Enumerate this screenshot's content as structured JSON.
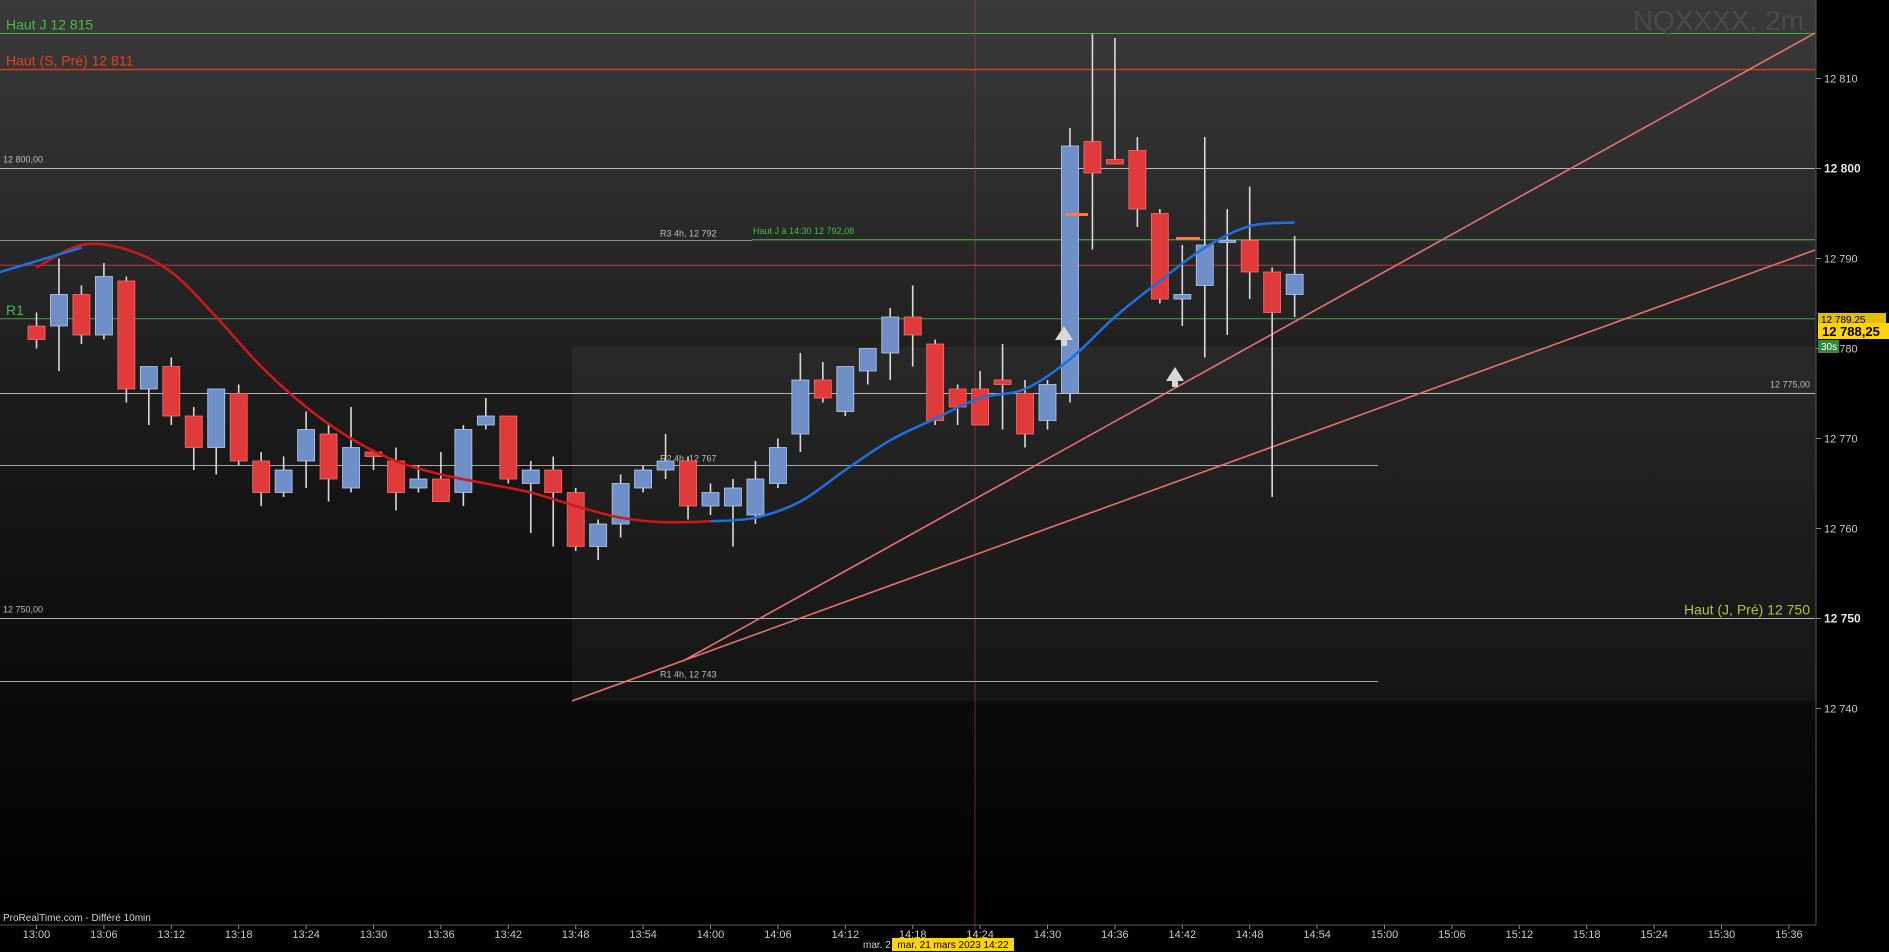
{
  "symbol": "NQXXXX, 2m",
  "watermark": "ProRealTime.com - Différé 10min",
  "crosshair_date": "mar. 21 mars 2023 14:22",
  "crosshair_date_prefix": "mar. 2",
  "price_tag": "12 788,25",
  "price_tag_small": "12 789,25",
  "timer_tag": "30s",
  "colors": {
    "up": "#6f8fc9",
    "down": "#e03a3a",
    "ma_red": "#d01818",
    "ma_blue": "#1e6fe0",
    "trend": "#e87070",
    "green": "#4bb84b",
    "orange": "#ff5a1e"
  },
  "chart_data": {
    "type": "candlestick",
    "timeframe": "2m",
    "ylim": [
      12735,
      12819
    ],
    "x_ticks": [
      "13:00",
      "13:06",
      "13:12",
      "13:18",
      "13:24",
      "13:30",
      "13:36",
      "13:42",
      "13:48",
      "13:54",
      "14:00",
      "14:06",
      "14:12",
      "14:18",
      "14:24",
      "14:30",
      "14:36",
      "14:42",
      "14:48",
      "14:54",
      "15:00",
      "15:06",
      "15:12",
      "15:18",
      "15:24",
      "15:30",
      "15:36"
    ],
    "y_ticks": [
      {
        "value": 12740,
        "label": "12 740",
        "major": false
      },
      {
        "value": 12750,
        "label": "12 750",
        "major": true
      },
      {
        "value": 12760,
        "label": "12 760",
        "major": false
      },
      {
        "value": 12770,
        "label": "12 770",
        "major": false
      },
      {
        "value": 12780,
        "label": "12 780",
        "major": false
      },
      {
        "value": 12790,
        "label": "12 790",
        "major": false
      },
      {
        "value": 12800,
        "label": "12 800",
        "major": true
      },
      {
        "value": 12810,
        "label": "12 810",
        "major": false
      }
    ],
    "candles": [
      {
        "t": "13:00",
        "o": 12782.5,
        "h": 12784.0,
        "l": 12780.0,
        "c": 12781.0
      },
      {
        "t": "13:02",
        "o": 12782.5,
        "h": 12790.0,
        "l": 12777.5,
        "c": 12786.0
      },
      {
        "t": "13:04",
        "o": 12786.0,
        "h": 12787.0,
        "l": 12780.5,
        "c": 12781.5
      },
      {
        "t": "13:06",
        "o": 12781.5,
        "h": 12789.5,
        "l": 12781.0,
        "c": 12788.0
      },
      {
        "t": "13:08",
        "o": 12787.5,
        "h": 12788.0,
        "l": 12774.0,
        "c": 12775.5
      },
      {
        "t": "13:10",
        "o": 12775.5,
        "h": 12778.0,
        "l": 12771.5,
        "c": 12778.0
      },
      {
        "t": "13:12",
        "o": 12778.0,
        "h": 12779.0,
        "l": 12771.5,
        "c": 12772.5
      },
      {
        "t": "13:14",
        "o": 12772.5,
        "h": 12773.5,
        "l": 12766.5,
        "c": 12769.0
      },
      {
        "t": "13:16",
        "o": 12769.0,
        "h": 12775.5,
        "l": 12766.0,
        "c": 12775.5
      },
      {
        "t": "13:18",
        "o": 12775.0,
        "h": 12776.0,
        "l": 12767.0,
        "c": 12767.5
      },
      {
        "t": "13:20",
        "o": 12767.5,
        "h": 12768.5,
        "l": 12762.5,
        "c": 12764.0
      },
      {
        "t": "13:22",
        "o": 12764.0,
        "h": 12768.0,
        "l": 12763.5,
        "c": 12766.5
      },
      {
        "t": "13:24",
        "o": 12767.5,
        "h": 12773.0,
        "l": 12764.5,
        "c": 12771.0
      },
      {
        "t": "13:26",
        "o": 12770.5,
        "h": 12771.5,
        "l": 12763.0,
        "c": 12765.5
      },
      {
        "t": "13:28",
        "o": 12764.5,
        "h": 12773.5,
        "l": 12764.0,
        "c": 12769.0
      },
      {
        "t": "13:30",
        "o": 12768.5,
        "h": 12768.5,
        "l": 12766.5,
        "c": 12768.0
      },
      {
        "t": "13:32",
        "o": 12767.5,
        "h": 12769.0,
        "l": 12762.0,
        "c": 12764.0
      },
      {
        "t": "13:34",
        "o": 12764.5,
        "h": 12767.0,
        "l": 12764.0,
        "c": 12765.5
      },
      {
        "t": "13:36",
        "o": 12765.5,
        "h": 12768.5,
        "l": 12763.0,
        "c": 12763.0
      },
      {
        "t": "13:38",
        "o": 12764.0,
        "h": 12771.5,
        "l": 12762.5,
        "c": 12771.0
      },
      {
        "t": "13:40",
        "o": 12771.5,
        "h": 12774.5,
        "l": 12771.0,
        "c": 12772.5
      },
      {
        "t": "13:42",
        "o": 12772.5,
        "h": 12772.5,
        "l": 12765.0,
        "c": 12765.5
      },
      {
        "t": "13:44",
        "o": 12765.0,
        "h": 12767.5,
        "l": 12759.5,
        "c": 12766.5
      },
      {
        "t": "13:46",
        "o": 12766.5,
        "h": 12768.0,
        "l": 12758.0,
        "c": 12764.0
      },
      {
        "t": "13:48",
        "o": 12764.0,
        "h": 12764.5,
        "l": 12757.5,
        "c": 12758.0
      },
      {
        "t": "13:50",
        "o": 12758.0,
        "h": 12761.0,
        "l": 12756.5,
        "c": 12760.5
      },
      {
        "t": "13:52",
        "o": 12760.5,
        "h": 12766.0,
        "l": 12759.0,
        "c": 12765.0
      },
      {
        "t": "13:54",
        "o": 12764.5,
        "h": 12767.0,
        "l": 12764.0,
        "c": 12766.5
      },
      {
        "t": "13:56",
        "o": 12766.5,
        "h": 12770.5,
        "l": 12765.5,
        "c": 12767.5
      },
      {
        "t": "13:58",
        "o": 12767.5,
        "h": 12768.0,
        "l": 12761.0,
        "c": 12762.5
      },
      {
        "t": "14:00",
        "o": 12762.5,
        "h": 12765.0,
        "l": 12761.5,
        "c": 12764.0
      },
      {
        "t": "14:02",
        "o": 12762.5,
        "h": 12765.5,
        "l": 12758.0,
        "c": 12764.5
      },
      {
        "t": "14:04",
        "o": 12761.5,
        "h": 12767.5,
        "l": 12760.5,
        "c": 12765.5
      },
      {
        "t": "14:06",
        "o": 12765.0,
        "h": 12770.0,
        "l": 12764.5,
        "c": 12769.0
      },
      {
        "t": "14:08",
        "o": 12770.5,
        "h": 12779.5,
        "l": 12768.5,
        "c": 12776.5
      },
      {
        "t": "14:10",
        "o": 12776.5,
        "h": 12778.5,
        "l": 12774.0,
        "c": 12774.5
      },
      {
        "t": "14:12",
        "o": 12773.0,
        "h": 12778.0,
        "l": 12772.5,
        "c": 12778.0
      },
      {
        "t": "14:14",
        "o": 12777.5,
        "h": 12780.0,
        "l": 12776.0,
        "c": 12780.0
      },
      {
        "t": "14:16",
        "o": 12779.5,
        "h": 12784.5,
        "l": 12776.5,
        "c": 12783.5
      },
      {
        "t": "14:18",
        "o": 12783.5,
        "h": 12787.0,
        "l": 12778.0,
        "c": 12781.5
      },
      {
        "t": "14:20",
        "o": 12780.5,
        "h": 12781.0,
        "l": 12771.5,
        "c": 12772.0
      },
      {
        "t": "14:22",
        "o": 12775.5,
        "h": 12776.0,
        "l": 12771.5,
        "c": 12773.5
      },
      {
        "t": "14:24",
        "o": 12775.5,
        "h": 12777.5,
        "l": 12771.5,
        "c": 12771.5
      },
      {
        "t": "14:26",
        "o": 12776.5,
        "h": 12780.5,
        "l": 12771.0,
        "c": 12776.0
      },
      {
        "t": "14:28",
        "o": 12775.0,
        "h": 12776.5,
        "l": 12769.0,
        "c": 12770.5
      },
      {
        "t": "14:30",
        "o": 12772.0,
        "h": 12776.5,
        "l": 12771.0,
        "c": 12776.0
      },
      {
        "t": "14:32",
        "o": 12775.0,
        "h": 12804.5,
        "l": 12774.0,
        "c": 12802.5
      },
      {
        "t": "14:34",
        "o": 12803.0,
        "h": 12815.0,
        "l": 12791.0,
        "c": 12799.5
      },
      {
        "t": "14:36",
        "o": 12801.0,
        "h": 12814.5,
        "l": 12800.5,
        "c": 12800.5
      },
      {
        "t": "14:38",
        "o": 12802.0,
        "h": 12803.5,
        "l": 12793.5,
        "c": 12795.5
      },
      {
        "t": "14:40",
        "o": 12795.0,
        "h": 12795.5,
        "l": 12785.0,
        "c": 12785.5
      },
      {
        "t": "14:42",
        "o": 12785.5,
        "h": 12791.5,
        "l": 12782.5,
        "c": 12786.0
      },
      {
        "t": "14:44",
        "o": 12787.0,
        "h": 12803.5,
        "l": 12779.0,
        "c": 12791.5
      },
      {
        "t": "14:46",
        "o": 12792.0,
        "h": 12795.5,
        "l": 12781.5,
        "c": 12792.0
      },
      {
        "t": "14:48",
        "o": 12792.0,
        "h": 12798.0,
        "l": 12785.5,
        "c": 12788.5
      },
      {
        "t": "14:50",
        "o": 12788.5,
        "h": 12789.0,
        "l": 12763.5,
        "c": 12784.0
      },
      {
        "t": "14:52",
        "o": 12786.0,
        "h": 12792.5,
        "l": 12783.5,
        "c": 12788.25
      }
    ],
    "ma_red": [
      {
        "t": "13:00",
        "y": 12789.0
      },
      {
        "t": "13:04",
        "y": 12791.5
      },
      {
        "t": "13:08",
        "y": 12791.0
      },
      {
        "t": "13:12",
        "y": 12788.5
      },
      {
        "t": "13:16",
        "y": 12783.5
      },
      {
        "t": "13:20",
        "y": 12778.0
      },
      {
        "t": "13:24",
        "y": 12773.5
      },
      {
        "t": "13:28",
        "y": 12770.0
      },
      {
        "t": "13:32",
        "y": 12767.5
      },
      {
        "t": "13:36",
        "y": 12766.0
      },
      {
        "t": "13:40",
        "y": 12765.0
      },
      {
        "t": "13:44",
        "y": 12764.0
      },
      {
        "t": "13:48",
        "y": 12762.5
      },
      {
        "t": "13:52",
        "y": 12761.2
      },
      {
        "t": "13:56",
        "y": 12760.7
      },
      {
        "t": "14:00",
        "y": 12760.8
      }
    ],
    "ma_blue": [
      {
        "t": "13:00",
        "y": 12788.5
      },
      {
        "t": "13:04",
        "y": 12791.2
      },
      {
        "t": "14:00",
        "y": 12760.8
      },
      {
        "t": "14:04",
        "y": 12761.2
      },
      {
        "t": "14:08",
        "y": 12763.0
      },
      {
        "t": "14:12",
        "y": 12766.5
      },
      {
        "t": "14:16",
        "y": 12769.8
      },
      {
        "t": "14:20",
        "y": 12772.2
      },
      {
        "t": "14:24",
        "y": 12774.5
      },
      {
        "t": "14:28",
        "y": 12775.5
      },
      {
        "t": "14:32",
        "y": 12778.8
      },
      {
        "t": "14:36",
        "y": 12783.5
      },
      {
        "t": "14:40",
        "y": 12787.5
      },
      {
        "t": "14:44",
        "y": 12791.2
      },
      {
        "t": "14:48",
        "y": 12793.6
      },
      {
        "t": "14:52",
        "y": 12794.0
      }
    ],
    "horizontal_levels": [
      {
        "name": "haut-j",
        "label": "Haut J 12 815",
        "value": 12815,
        "color": "#4bb84b"
      },
      {
        "name": "haut-s-pre",
        "label": "Haut (S, Pré) 12 811",
        "value": 12811,
        "color": "#e8401e"
      },
      {
        "name": "level-12800",
        "label": "12 800,00",
        "value": 12800,
        "color": "#d0d0d0"
      },
      {
        "name": "haut-j-1430",
        "label": "Haut J à 14:30 12 792,08",
        "value": 12792.08,
        "color": "#4bb84b"
      },
      {
        "name": "r3-4h",
        "label": "R3 4h, 12 792",
        "value": 12792,
        "color": "#bdbdbd"
      },
      {
        "name": "price-line",
        "label": "",
        "value": 12789.25,
        "color": "#c04a4a"
      },
      {
        "name": "r1-green",
        "label": "R1",
        "value": 12783.3,
        "color": "#4bb84b"
      },
      {
        "name": "level-12775",
        "label": "12 775,00",
        "value": 12775,
        "color": "#d0d0d0"
      },
      {
        "name": "r2-4h",
        "label": "R2 4h, 12 767",
        "value": 12767,
        "color": "#bdbdbd"
      },
      {
        "name": "level-12750",
        "label": "12 750,00",
        "value": 12750,
        "color": "#d0d0d0"
      },
      {
        "name": "haut-j-pre",
        "label": "Haut (J, Pré) 12 750",
        "value": 12750,
        "color": "#a8c83a"
      },
      {
        "name": "r1-4h",
        "label": "R1 4h, 12 743",
        "value": 12743,
        "color": "#bdbdbd"
      }
    ]
  }
}
